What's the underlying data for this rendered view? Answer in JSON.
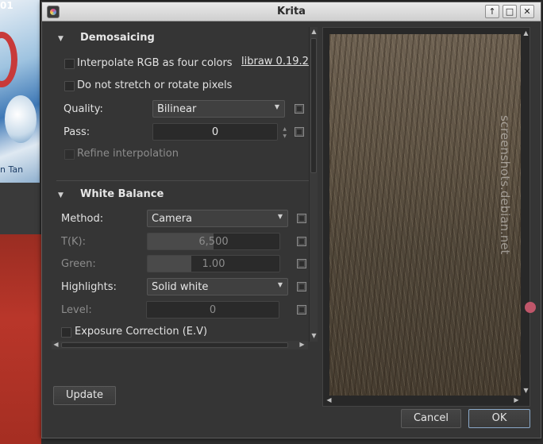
{
  "background": {
    "art_text_top": "01",
    "art_text_bottom": "n Tan"
  },
  "window": {
    "title": "Krita",
    "controls": [
      "↑",
      "□",
      "✕"
    ]
  },
  "demosaicing": {
    "title": "Demosaicing",
    "libraw_label": "libraw 0.19.2",
    "interpolate_label": "Interpolate RGB as four colors",
    "no_stretch_label": "Do not stretch or rotate pixels",
    "quality_label": "Quality:",
    "quality_value": "Bilinear",
    "pass_label": "Pass:",
    "pass_value": "0",
    "refine_label": "Refine interpolation"
  },
  "white_balance": {
    "title": "White Balance",
    "method_label": "Method:",
    "method_value": "Camera",
    "temp_label": "T(K):",
    "temp_value": "6,500",
    "temp_fraction": 0.5,
    "green_label": "Green:",
    "green_value": "1.00",
    "green_fraction": 0.33,
    "highlights_label": "Highlights:",
    "highlights_value": "Solid white",
    "level_label": "Level:",
    "level_value": "0",
    "exposure_label": "Exposure Correction (E.V)"
  },
  "preview": {
    "watermark": "screenshots.debian.net"
  },
  "buttons": {
    "update": "Update",
    "cancel": "Cancel",
    "ok": "OK"
  }
}
